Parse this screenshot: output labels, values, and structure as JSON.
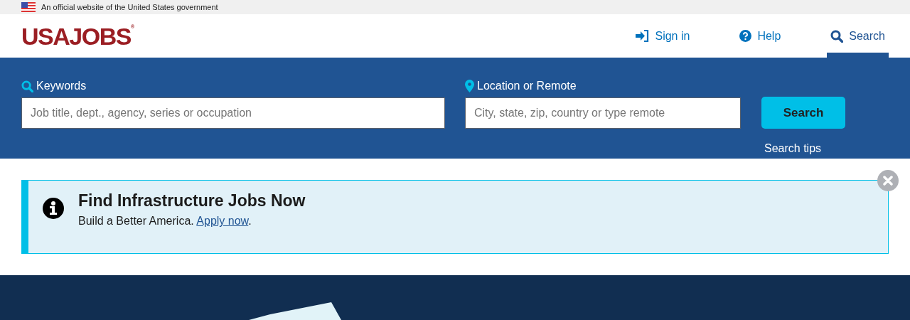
{
  "gov_banner": {
    "text": "An official website of the United States government"
  },
  "header": {
    "logo": "USAJOBS$^{®}$",
    "nav": [
      {
        "kind": "signin",
        "label": "Sign in",
        "selected": false
      },
      {
        "kind": "help",
        "label": "Help",
        "selected": false
      },
      {
        "kind": "search",
        "label": "Search",
        "selected": true
      }
    ]
  },
  "search": {
    "keywords": {
      "label": "Keywords",
      "placeholder": "Job title, dept., agency, series or occupation"
    },
    "location": {
      "label": "Location or Remote",
      "placeholder": "City, state, zip, country or type remote"
    },
    "button": "Search",
    "tips": "Search tips"
  },
  "alert": {
    "title": "Find Infrastructure Jobs Now",
    "text": "Build a Better America.",
    "link": "Apply now",
    "after": "."
  }
}
